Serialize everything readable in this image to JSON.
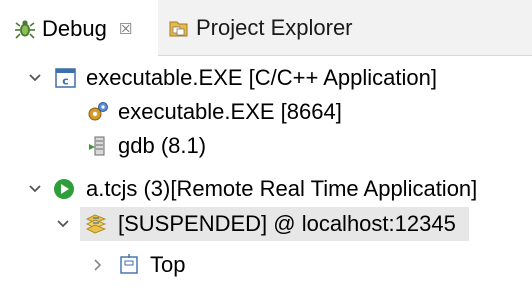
{
  "tabs": {
    "debug": {
      "label": "Debug",
      "close": "☒",
      "icon": "debug-bug-icon"
    },
    "project_explorer": {
      "label": "Project Explorer",
      "icon": "project-explorer-icon"
    }
  },
  "tree": {
    "items": [
      {
        "label": "executable.EXE [C/C++ Application]",
        "icon": "c-application-icon",
        "expanded": true
      },
      {
        "label": "executable.EXE [8664]",
        "icon": "process-gears-icon"
      },
      {
        "label": "gdb (8.1)",
        "icon": "gdb-icon"
      },
      {
        "label": "a.tcjs (3)[Remote Real Time Application]",
        "icon": "launch-green-icon",
        "expanded": true
      },
      {
        "label": "[SUSPENDED] @ localhost:12345",
        "icon": "suspended-thread-icon",
        "expanded": true,
        "selected": true
      },
      {
        "label": "Top",
        "icon": "stack-frame-icon",
        "expanded": false
      }
    ]
  }
}
